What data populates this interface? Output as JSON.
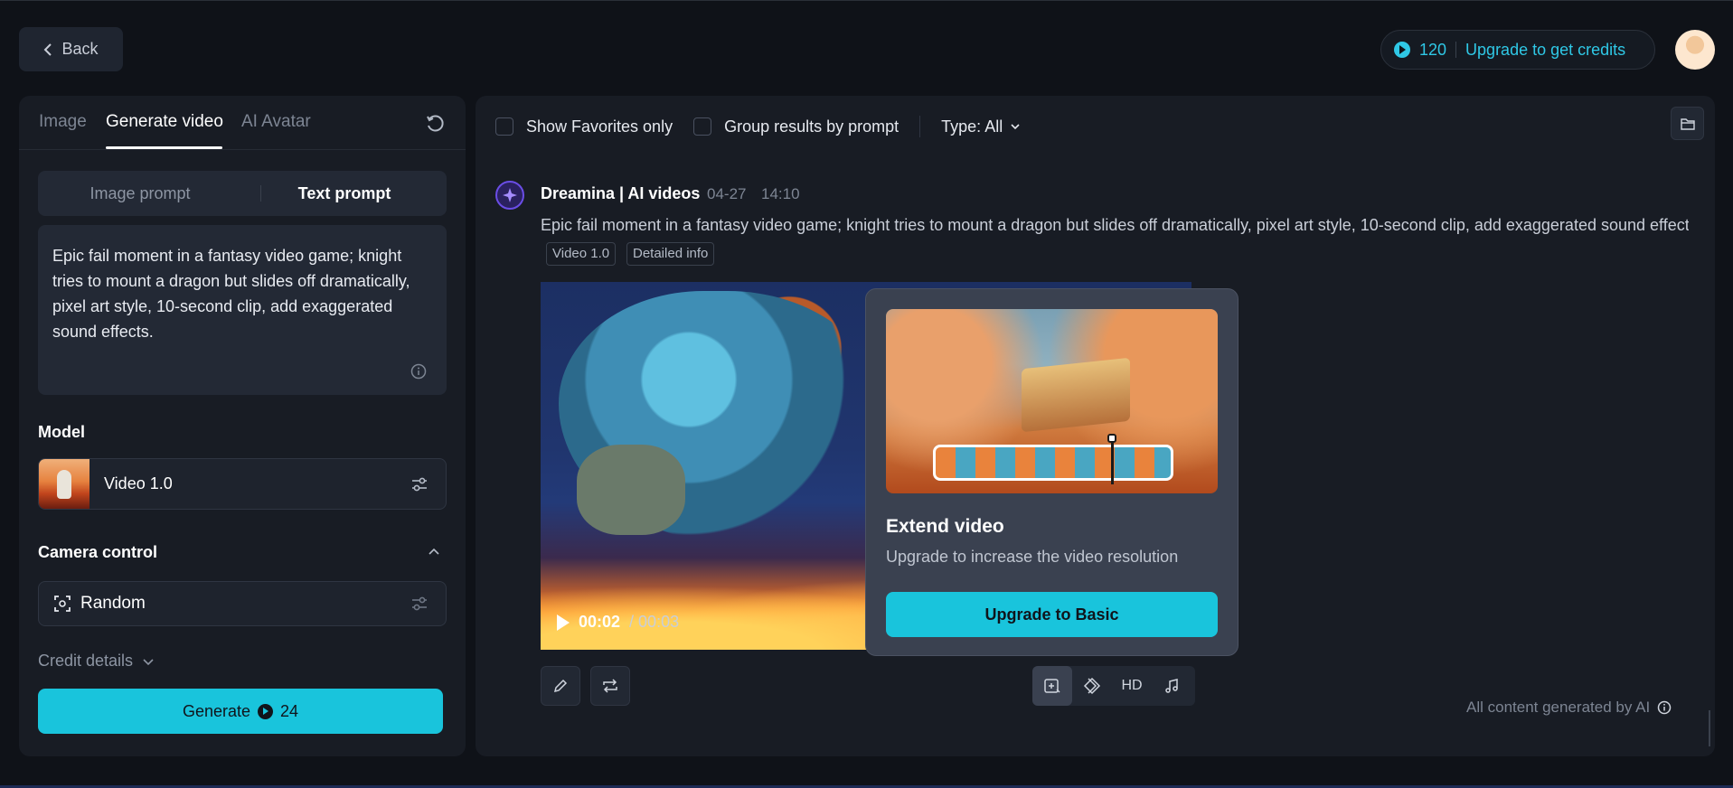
{
  "header": {
    "back_label": "Back",
    "credits": "120",
    "upgrade_label": "Upgrade to get credits",
    "accent_color": "#19c4dc"
  },
  "left_panel": {
    "tabs": [
      {
        "label": "Image"
      },
      {
        "label": "Generate video"
      },
      {
        "label": "AI Avatar"
      }
    ],
    "active_tab": "Generate video",
    "prompt_modes": [
      {
        "label": "Image prompt"
      },
      {
        "label": "Text prompt"
      }
    ],
    "active_prompt_mode": "Text prompt",
    "prompt_text": "Epic fail moment in a fantasy video game; knight tries to mount a dragon but slides off dramatically, pixel art style, 10-second clip, add exaggerated sound effects.",
    "model_label": "Model",
    "model_name": "Video 1.0",
    "camera_label": "Camera control",
    "camera_value": "Random",
    "credit_details_label": "Credit details",
    "generate_label": "Generate",
    "generate_cost": "24"
  },
  "results": {
    "filters": {
      "favorites_label": "Show Favorites only",
      "group_label": "Group results by prompt",
      "type_label": "Type: All"
    },
    "item": {
      "author": "Dreamina | AI videos",
      "date": "04-27",
      "time": "14:10",
      "prompt": "Epic fail moment in a fantasy video game; knight tries to mount a dragon but slides off dramatically, pixel art style, 10-second clip, add exaggerated sound effects.",
      "tags": [
        "Video 1.0",
        "Detailed info"
      ],
      "time_current": "00:02",
      "time_total": "/ 00:03"
    },
    "popover": {
      "title": "Extend video",
      "subtitle": "Upgrade to increase the video resolution",
      "button_label": "Upgrade to Basic"
    },
    "tools": {
      "hd_label": "HD"
    },
    "footer_note": "All content generated by AI"
  }
}
